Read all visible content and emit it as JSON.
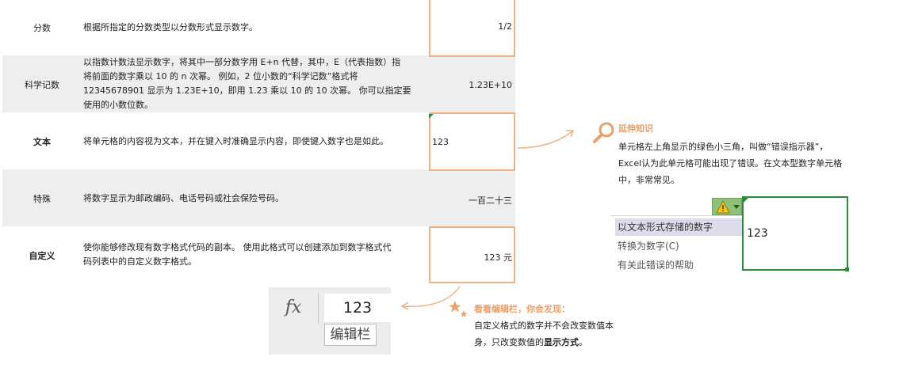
{
  "rows": [
    {
      "category": "分数",
      "description": "根据所指定的分数类型以分数形式显示数字。",
      "example": "1/2"
    },
    {
      "category": "科学记数",
      "description_lines": [
        "以指数计数法显示数字，将其中一部分数字用 E+n 代替，其中，E（代表指数）指",
        "将前面的数字乘以 10 的 n 次幂。 例如，2 位小数的“科学记数”格式将",
        "12345678901 显示为 1.23E+10，即用 1.23 乘以 10 的 10 次幂。 你可以指定要",
        "使用的小数位数。"
      ],
      "example": "1.23E+10"
    },
    {
      "category": "文本",
      "description": "将单元格的内容视为文本，并在键入时准确显示内容，即使键入数字也是如此。",
      "example": "123"
    },
    {
      "category": "特殊",
      "description": "将数字显示为邮政编码、电话号码或社会保险号码。",
      "example": "一百二十三"
    },
    {
      "category": "自定义",
      "description_lines": [
        "使你能够修改现有数字格式代码的副本。 使用此格式可以创建添加到数字格式代",
        "码列表中的自定义数字格式。"
      ],
      "example": "123 元"
    }
  ],
  "formula_bar": {
    "fx_label": "fx",
    "value": "123",
    "caption": "编辑栏"
  },
  "note_extend": {
    "title": "延伸知识",
    "lines": [
      "单元格左上角显示的绿色小三角，叫做“错误指示器”，",
      "Excel认为此单元格可能出现了错误。在文本型数字单元格",
      "中，非常常见。"
    ]
  },
  "error_menu": {
    "items": [
      "以文本形式存储的数字",
      "转换为数字(C)",
      "有关此错误的帮助"
    ],
    "cell_value": "123"
  },
  "note_formula": {
    "title": "看看编辑栏，你会发现：",
    "line1": "自定义格式的数字并不会改变数值本",
    "line2_prefix": "身，只改变数值的",
    "line2_bold": "显示方式",
    "line2_suffix": "。"
  },
  "colors": {
    "accent": "#e8a06c",
    "border": "#f0b088",
    "green": "#2e8b3c",
    "shade": "#eeeeee"
  }
}
